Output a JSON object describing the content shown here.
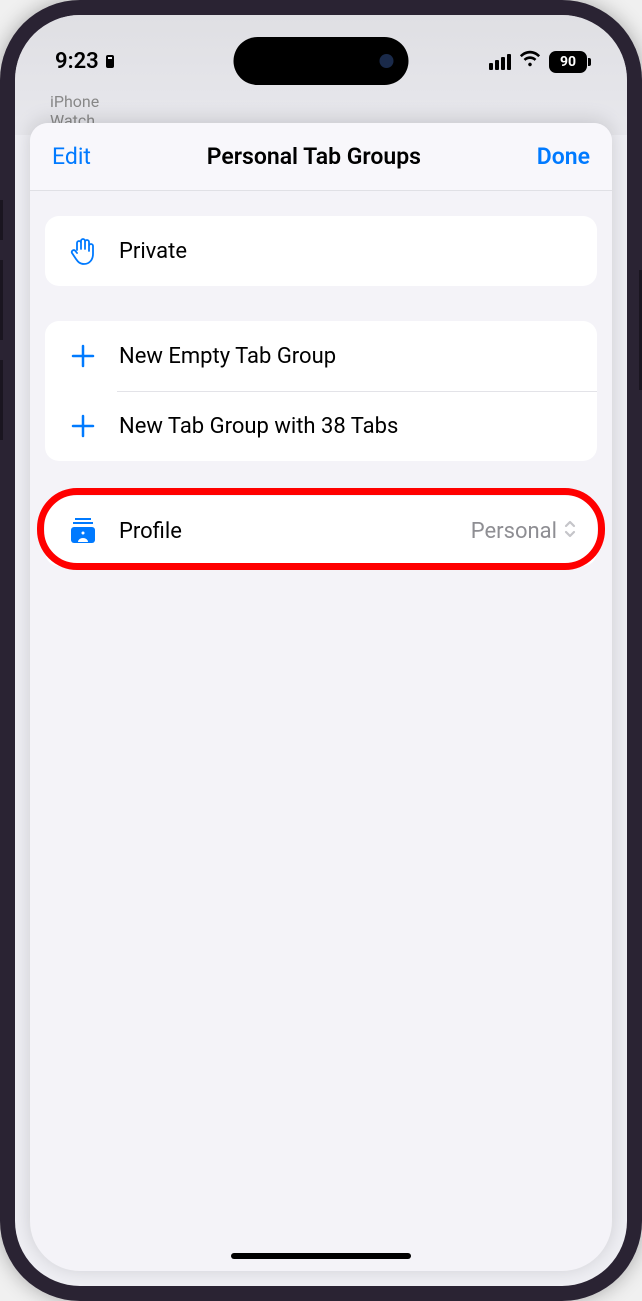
{
  "status": {
    "time": "9:23",
    "battery": "90"
  },
  "background": {
    "line1": "iPhone",
    "line2": "Watch"
  },
  "header": {
    "edit": "Edit",
    "title": "Personal Tab Groups",
    "done": "Done"
  },
  "groups": {
    "private": "Private",
    "newEmpty": "New Empty Tab Group",
    "newWithTabs": "New Tab Group with 38 Tabs"
  },
  "profile": {
    "label": "Profile",
    "value": "Personal"
  }
}
